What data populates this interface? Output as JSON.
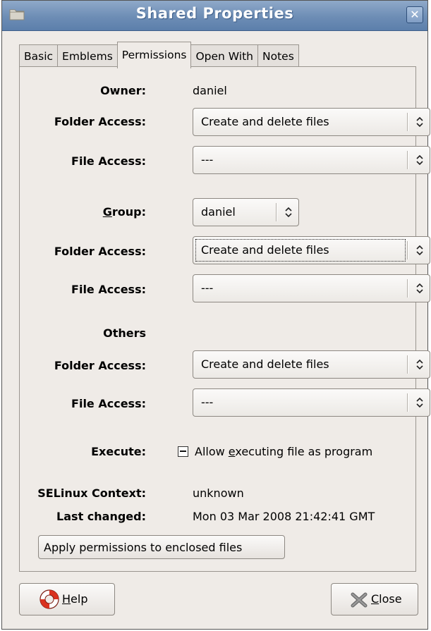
{
  "window": {
    "title": "Shared Properties",
    "close_glyph": "✕"
  },
  "tabs": [
    "Basic",
    "Emblems",
    "Permissions",
    "Open With",
    "Notes"
  ],
  "active_tab": "Permissions",
  "owner": {
    "label": "Owner:",
    "value": "daniel",
    "folder_access_label": "Folder Access:",
    "folder_access_value": "Create and delete files",
    "file_access_label": "File Access:",
    "file_access_value": "---"
  },
  "group": {
    "label_mnemonic": "G",
    "label_rest": "roup:",
    "value": "daniel",
    "folder_access_label": "Folder Access:",
    "folder_access_value": "Create and delete files",
    "file_access_label": "File Access:",
    "file_access_value": "---"
  },
  "others": {
    "label": "Others",
    "folder_access_label": "Folder Access:",
    "folder_access_value": "Create and delete files",
    "file_access_label": "File Access:",
    "file_access_value": "---"
  },
  "execute": {
    "label": "Execute:",
    "checkbox_text_pre": "Allow ",
    "checkbox_text_mnemonic": "e",
    "checkbox_text_post": "xecuting file as program",
    "state": "inconsistent"
  },
  "selinux": {
    "label": "SELinux Context:",
    "value": "unknown"
  },
  "last_changed": {
    "label": "Last changed:",
    "value": "Mon 03 Mar 2008 21:42:41 GMT"
  },
  "apply_button": "Apply permissions to enclosed files",
  "footer": {
    "help_mnemonic": "H",
    "help_rest": "elp",
    "close_mnemonic": "C",
    "close_rest": "lose"
  },
  "icons": {
    "title": "folder-icon",
    "help": "lifebuoy-icon",
    "close": "x-icon"
  }
}
